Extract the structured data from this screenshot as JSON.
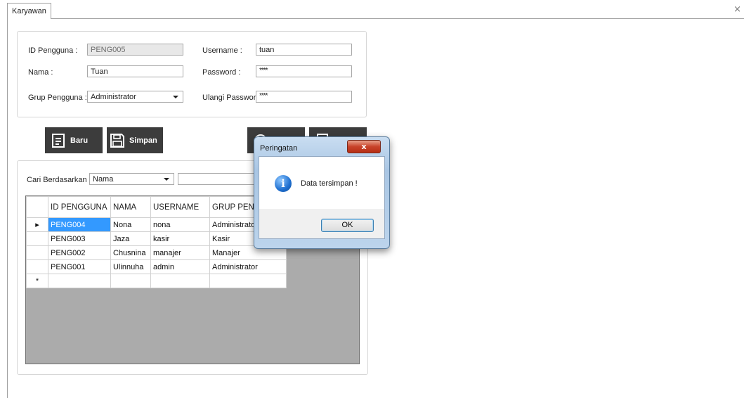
{
  "tab": {
    "label": "Karyawan",
    "close": "×"
  },
  "form": {
    "id_label": "ID Pengguna :",
    "id_value": "PENG005",
    "nama_label": "Nama :",
    "nama_value": "Tuan",
    "grup_label": "Grup Pengguna :",
    "grup_value": "Administrator",
    "username_label": "Username :",
    "username_value": "tuan",
    "password_label": "Password :",
    "password_value": "****",
    "ulangi_label": "Ulangi Password :",
    "ulangi_value": "****"
  },
  "buttons": {
    "baru": "Baru",
    "simpan": "Simpan"
  },
  "search": {
    "label": "Cari Berdasarkan :",
    "field": "Nama",
    "value": ""
  },
  "grid": {
    "headers": [
      "ID PENGGUNA",
      "NAMA",
      "USERNAME",
      "GRUP PENGGUNA"
    ],
    "rows": [
      [
        "PENG004",
        "Nona",
        "nona",
        "Administrator"
      ],
      [
        "PENG003",
        "Jaza",
        "kasir",
        "Kasir"
      ],
      [
        "PENG002",
        "Chusnina",
        "manajer",
        "Manajer"
      ],
      [
        "PENG001",
        "Ulinnuha",
        "admin",
        "Administrator"
      ]
    ],
    "selected_marker": "▸",
    "new_row_marker": "*"
  },
  "dialog": {
    "title": "Peringatan",
    "close": "x",
    "message": "Data tersimpan !",
    "ok": "OK",
    "icon": "info-icon"
  }
}
